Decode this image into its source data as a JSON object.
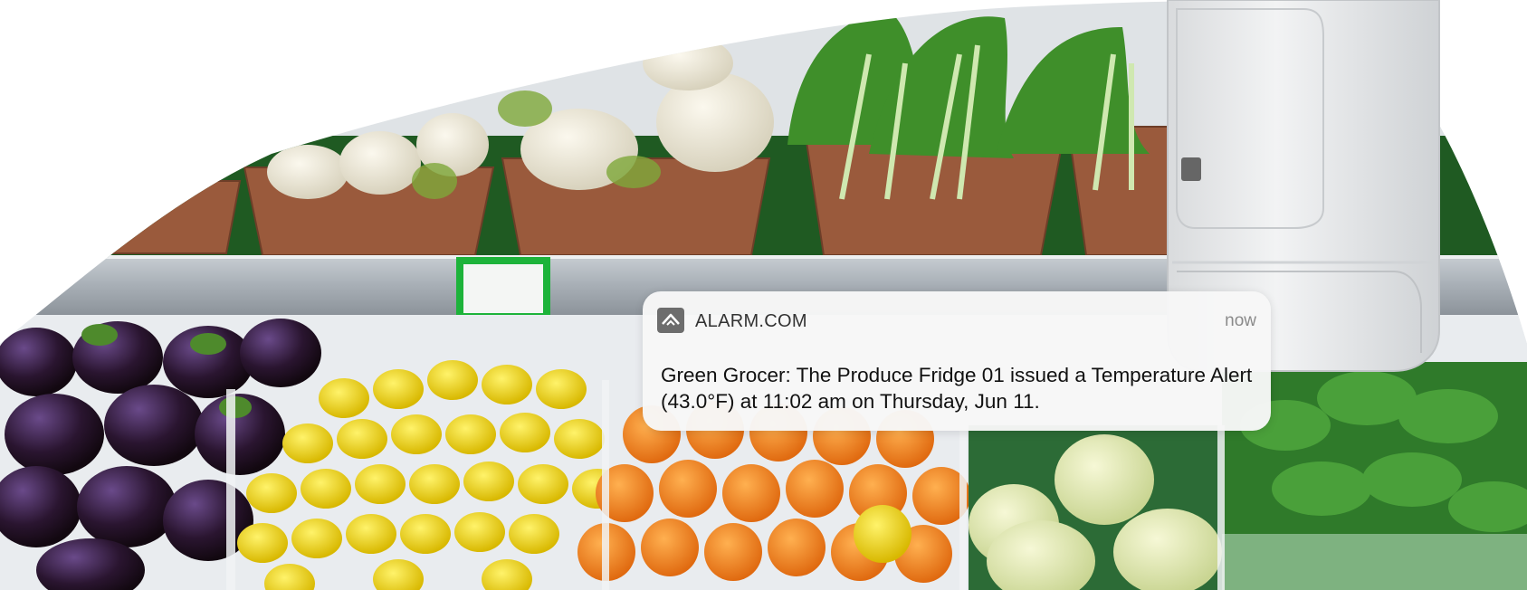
{
  "notification": {
    "app_name": "ALARM.COM",
    "time": "now",
    "message": "Green Grocer: The Produce Fridge 01 issued a Temperature Alert (43.0°F) at 11:02 am on Thursday, Jun 11.",
    "app_icon": "alarm-com-logo-icon"
  },
  "scene": {
    "description_icon": "produce-display-photo",
    "device_icon": "temperature-sensor-icon"
  },
  "colors": {
    "card_background": "#f7f7f7",
    "text_primary": "#111111",
    "text_secondary": "#8a8a8a"
  }
}
